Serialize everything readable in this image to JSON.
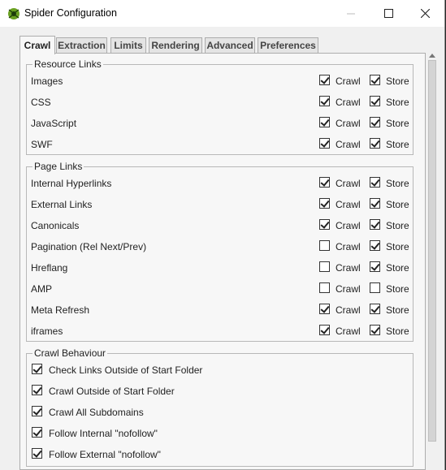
{
  "window": {
    "title": "Spider Configuration"
  },
  "tabs": [
    {
      "label": "Crawl",
      "active": true
    },
    {
      "label": "Extraction",
      "active": false
    },
    {
      "label": "Limits",
      "active": false
    },
    {
      "label": "Rendering",
      "active": false
    },
    {
      "label": "Advanced",
      "active": false
    },
    {
      "label": "Preferences",
      "active": false
    }
  ],
  "crawl_label": "Crawl",
  "store_label": "Store",
  "resource_links": {
    "title": "Resource Links",
    "items": [
      {
        "label": "Images",
        "crawl": true,
        "store": true
      },
      {
        "label": "CSS",
        "crawl": true,
        "store": true
      },
      {
        "label": "JavaScript",
        "crawl": true,
        "store": true
      },
      {
        "label": "SWF",
        "crawl": true,
        "store": true
      }
    ]
  },
  "page_links": {
    "title": "Page Links",
    "items": [
      {
        "label": "Internal Hyperlinks",
        "crawl": true,
        "store": true
      },
      {
        "label": "External Links",
        "crawl": true,
        "store": true
      },
      {
        "label": "Canonicals",
        "crawl": true,
        "store": true
      },
      {
        "label": "Pagination (Rel Next/Prev)",
        "crawl": false,
        "store": true
      },
      {
        "label": "Hreflang",
        "crawl": false,
        "store": true
      },
      {
        "label": "AMP",
        "crawl": false,
        "store": false
      },
      {
        "label": "Meta Refresh",
        "crawl": true,
        "store": true
      },
      {
        "label": "iframes",
        "crawl": true,
        "store": true
      }
    ]
  },
  "crawl_behaviour": {
    "title": "Crawl Behaviour",
    "items": [
      {
        "label": "Check Links Outside of Start Folder",
        "checked": true
      },
      {
        "label": "Crawl Outside of Start Folder",
        "checked": true
      },
      {
        "label": "Crawl All Subdomains",
        "checked": true
      },
      {
        "label": "Follow Internal \"nofollow\"",
        "checked": true
      },
      {
        "label": "Follow External \"nofollow\"",
        "checked": true
      }
    ]
  }
}
